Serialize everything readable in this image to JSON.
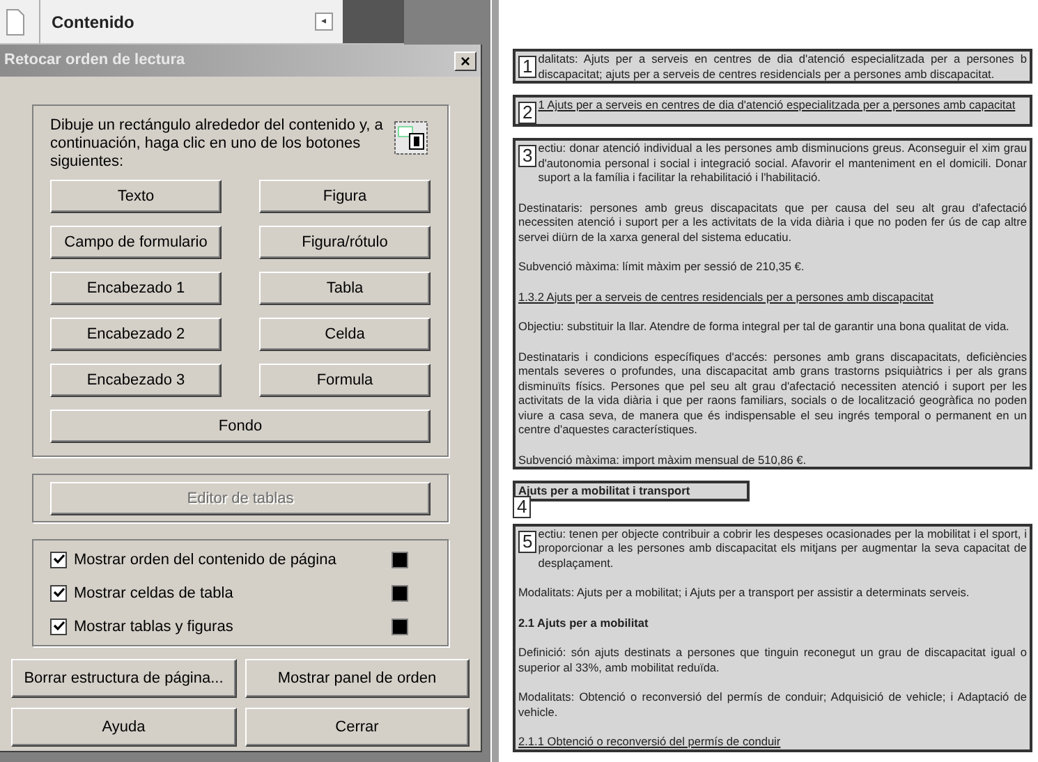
{
  "panel": {
    "title": "Contenido",
    "collapse_button": "◂"
  },
  "dialog": {
    "title": "Retocar orden de lectura",
    "close": "×",
    "instructions": "Dibuje un rectángulo alrededor del contenido y, a continuación, haga clic en uno de los botones siguientes:",
    "tag_buttons": [
      {
        "label": "Texto"
      },
      {
        "label": "Figura"
      },
      {
        "label": "Campo de formulario"
      },
      {
        "label": "Figura/rótulo"
      },
      {
        "label": "Encabezado 1"
      },
      {
        "label": "Tabla"
      },
      {
        "label": "Encabezado 2"
      },
      {
        "label": "Celda"
      },
      {
        "label": "Encabezado 3"
      },
      {
        "label": "Formula"
      }
    ],
    "wide_button": {
      "label": "Fondo"
    },
    "table_editor": {
      "label": "Editor de tablas",
      "disabled": true
    },
    "options": [
      {
        "label": "Mostrar orden del contenido de página",
        "checked": true,
        "color": "#000000"
      },
      {
        "label": "Mostrar celdas de tabla",
        "checked": true,
        "color": "#000000"
      },
      {
        "label": "Mostrar tablas y figuras",
        "checked": true,
        "color": "#000000"
      }
    ],
    "buttons": [
      {
        "label": "Borrar estructura de página..."
      },
      {
        "label": "Mostrar panel de orden"
      },
      {
        "label": "Ayuda"
      },
      {
        "label": "Cerrar"
      }
    ]
  },
  "document": {
    "blocks": [
      {
        "number": "1",
        "short": false,
        "paragraphs": [
          {
            "kind": "text",
            "text": "dalitats: Ajuts per a serveis en centres de dia d'atenció especialitzada per a persones b discapacitat; ajuts per a serveis de centres residencials per a persones amb discapacitat."
          }
        ]
      },
      {
        "number": "2",
        "short": false,
        "paragraphs": [
          {
            "kind": "link",
            "text": "1 Ajuts per a serveis en centres de dia d'atenció especialitzada per a persones amb capacitat"
          }
        ]
      },
      {
        "number": "3",
        "short": false,
        "paragraphs": [
          {
            "kind": "text",
            "text": "ectiu: donar atenció individual a les persones amb disminucions greus. Aconseguir el xim grau d'autonomia personal i social i integració social. Afavorir el manteniment en el domicili. Donar suport a la família i facilitar la rehabilitació i l'habilitació."
          },
          {
            "kind": "text",
            "text": "Destinataris: persones amb greus discapacitats que per causa del seu alt grau d'afectació necessiten atenció i suport per a les activitats de la vida diària i que no poden fer ús de cap altre servei diürn de la xarxa general del sistema educatiu."
          },
          {
            "kind": "text",
            "text": "Subvenció màxima: límit màxim per sessió de 210,35 €."
          },
          {
            "kind": "link",
            "text": "1.3.2 Ajuts per a serveis de centres residencials per a persones amb discapacitat"
          },
          {
            "kind": "text",
            "text": "Objectiu: substituir la llar. Atendre de forma integral per tal de garantir una bona qualitat de vida."
          },
          {
            "kind": "text",
            "text": "Destinataris i condicions específiques d'accés: persones amb grans discapacitats, deficiències mentals severes o profundes, una discapacitat amb grans trastorns psiquiàtrics i per als grans disminuïts físics. Persones que pel seu alt grau d'afectació necessiten atenció i suport per les activitats de la vida diària i que per raons familiars, socials o de localització geogràfica no poden viure a casa seva, de manera que és indispensable el seu ingrés temporal o permanent en un centre d'aquestes característiques."
          },
          {
            "kind": "text",
            "text": "Subvenció màxima: import màxim mensual de 510,86 €."
          }
        ]
      },
      {
        "number": "4",
        "short": true,
        "paragraphs": [
          {
            "kind": "heading",
            "text": "Ajuts per a mobilitat i transport"
          }
        ]
      },
      {
        "number": "5",
        "short": false,
        "paragraphs": [
          {
            "kind": "text",
            "text": "ectiu: tenen per objecte contribuir a cobrir les despeses ocasionades per la mobilitat i el sport, i proporcionar a les persones amb discapacitat els mitjans per augmentar la seva capacitat de desplaçament."
          },
          {
            "kind": "text",
            "text": "Modalitats: Ajuts per a mobilitat; i Ajuts per a transport per assistir a determinats serveis."
          },
          {
            "kind": "heading",
            "text": "2.1 Ajuts per a mobilitat"
          },
          {
            "kind": "text",
            "text": "Definició: són ajuts destinats a persones que tinguin reconegut un grau de discapacitat igual o superior al 33%, amb mobilitat reduïda."
          },
          {
            "kind": "text",
            "text": "Modalitats: Obtenció o reconversió del permís de conduir; Adquisició de vehicle; i Adaptació de vehicle."
          },
          {
            "kind": "link",
            "text": "2.1.1 Obtenció o reconversió del permís de conduir"
          }
        ]
      }
    ]
  }
}
